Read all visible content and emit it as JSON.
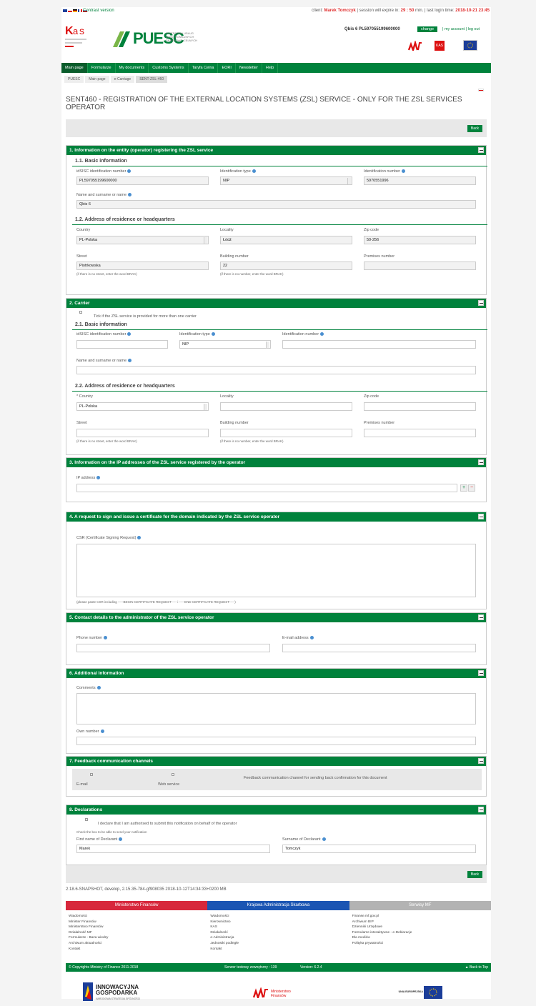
{
  "topbar": {
    "contrast": "Contrast version",
    "client_label": "client:",
    "client_name": "Marek Tomczyk",
    "expire_label": "| session will expire in:",
    "expire_time": "29 : 50",
    "expire_unit": "min.",
    "last_login_label": "| last login time:",
    "last_login": "2018-10-21 23:45"
  },
  "header": {
    "logo_text": "PUESC",
    "logo_sub": "PLATFORMA USŁUG ELEKTRONICZNYCH SKARBOWO-CELNYCH",
    "company": "Qbis 6 PL597055199600000",
    "change": "change",
    "links": "| my account | log out",
    "kas": "KAS"
  },
  "nav": [
    "Main page",
    "Formularze",
    "My documents",
    "Customs Systems",
    "Taryfa Celna",
    "EORI",
    "Newsletter",
    "Help"
  ],
  "breadcrumb": [
    "PUESC",
    "Main page",
    "e-Carriage",
    "SENT-ZSL-460"
  ],
  "page_title": "SENT460 - REGISTRATION OF THE EXTERNAL LOCATION SYSTEMS (ZSL) SERVICE - ONLY FOR THE ZSL SERVICES OPERATOR",
  "back": "Back",
  "s1": {
    "title": "1. Information on the entity (operator) registering the ZSL service",
    "basic": "1.1. Basic information",
    "idsisc_label": "idSISC identification number",
    "idsisc": "PL597055199600000",
    "idtype_label": "Identification type",
    "idtype": "NIP",
    "idnum_label": "Identification number",
    "idnum": "5970551996",
    "name_label": "Name and surname or name",
    "name": "Qbis 6",
    "addr": "1.2. Address of residence or headquarters",
    "country_label": "Country",
    "country": "PL-Polska",
    "locality_label": "Locality",
    "locality": "Łódź",
    "zip_label": "Zip code",
    "zip": "50-256",
    "street_label": "Street",
    "street": "Piotrkowska",
    "building_label": "Building number",
    "building": "22",
    "premises_label": "Premises number",
    "street_note": "(if there is no street, enter the word BRAK)",
    "building_note": "(if there is no number, enter the word BRAK)"
  },
  "s2": {
    "title": "2. Carrier",
    "tick": "Tick if the ZSL service is provided for more than one carrier",
    "basic": "2.1. Basic information",
    "idsisc_label": "idSISC identification number",
    "idtype_label": "Identification type",
    "idtype": "NIP",
    "idnum_label": "Identification number",
    "name_label": "Name and surname or name",
    "addr": "2.2. Address of residence or headquarters",
    "country_label": "* Country",
    "country": "PL-Polska",
    "locality_label": "Locality",
    "zip_label": "Zip code",
    "street_label": "Street",
    "building_label": "Building number",
    "premises_label": "Premises number",
    "street_note": "(if there is no street, enter the word BRAK)",
    "building_note": "(if there is no number, enter the word BRAK)"
  },
  "s3": {
    "title": "3. Information on the IP addresses of the ZSL service registered by the operator",
    "ip_label": "IP address"
  },
  "s4": {
    "title": "4. A request to sign and issue a certificate for the domain indicated by the ZSL service operator",
    "csr_label": "CSR (Certificate Signing Request)",
    "note": "(please paste CSR including -----BEGIN CERTIFICATE REQUEST----- i -----END CERTIFICATE REQUEST-----)"
  },
  "s5": {
    "title": "5. Contact details to the administrator of the ZSL service operator",
    "phone_label": "Phone number",
    "email_label": "E-mail address"
  },
  "s6": {
    "title": "6. Additional Information",
    "comments_label": "Comments",
    "own_label": "Own number"
  },
  "s7": {
    "title": "7. Feedback communication channels",
    "email": "E-mail",
    "ws": "Web service",
    "desc": "Feedback communication channel for sending back confirmation for this document"
  },
  "s8": {
    "title": "8. Declarations",
    "declare": "I declare that I am authorised to submit this notification on behalf of the operator",
    "check_note": "Check the box to be able to send your notification",
    "first_label": "First name of Declarant",
    "first": "Marek",
    "sur_label": "Surname of Declarant",
    "sur": "Tomczyk"
  },
  "version": "2.18.6-SNAPSHOT, develop, 2.15.35-784-gf908035 2018-10-12T14:34:33+0200 MB",
  "footer": {
    "tabs": [
      {
        "label": "Ministerstwo Finansów",
        "color": "#d7283c"
      },
      {
        "label": "Krajowa Administracja Skarbowa",
        "color": "#1b55b3"
      },
      {
        "label": "Serwisy MF",
        "color": "#b3b3b3"
      }
    ],
    "col1": [
      "Wiadomości",
      "Minister Finansów",
      "Ministerstwo Finansów",
      "Działalność MF",
      "Formularze - Baza wiedzy",
      "Archiwum aktualności",
      "Kontakt"
    ],
    "col2": [
      "Wiadomości",
      "Kierownictwo",
      "KAS",
      "Działalność",
      "e-Administracja",
      "Jednostki podległe",
      "Kontakt"
    ],
    "col3": [
      "Finanse.mf.gov.pl",
      "Archiwum BIP",
      "Dzienniki Urzędowe",
      "Formularze interaktywne - e-Deklaracje",
      "Dla mediów",
      "Polityka prywatności"
    ],
    "copyright": "© Copyrights Ministry of Finance 2011-2018",
    "server": "Serwer testowy zewnętrzny : 139",
    "ver": "Version: 6.2.4",
    "back_top": "▲ Back to Top"
  },
  "partners": {
    "innow1": "INNOWACYJNA",
    "innow2": "GOSPODARKA",
    "innow3": "NARODOWA STRATEGIA SPÓJNOŚCI",
    "mf": "Ministerstwo Finansów",
    "eu": "UNIA EUROPEJSKA"
  }
}
